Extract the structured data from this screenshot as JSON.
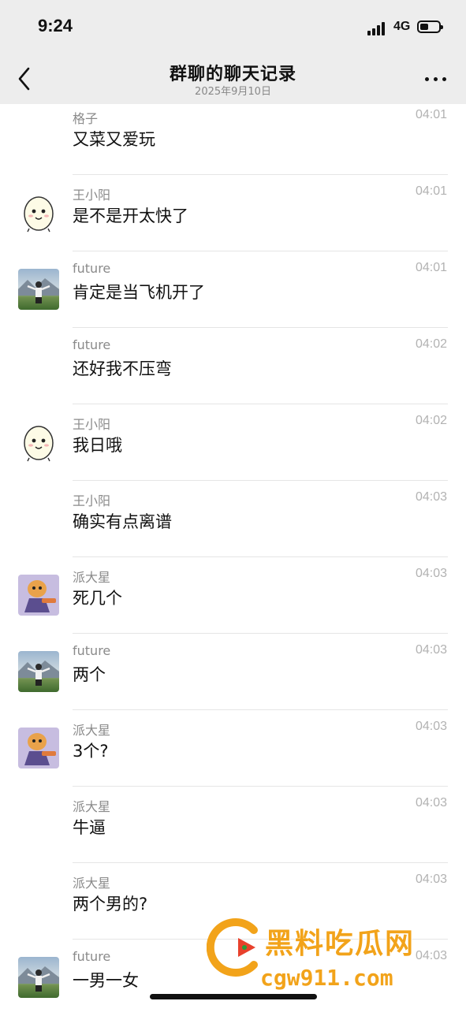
{
  "status": {
    "time": "9:24",
    "network": "4G",
    "battery_level": 0.45
  },
  "header": {
    "title": "群聊的聊天记录",
    "subtitle": "2025年9月10日"
  },
  "messages": [
    {
      "sender": "格子",
      "time": "04:01",
      "text": "又菜又爱玩",
      "avatar": "none"
    },
    {
      "sender": "王小阳",
      "time": "04:01",
      "text": "是不是开太快了",
      "avatar": "egg"
    },
    {
      "sender": "future",
      "time": "04:01",
      "text": "肯定是当飞机开了",
      "avatar": "future"
    },
    {
      "sender": "future",
      "time": "04:02",
      "text": "还好我不压弯",
      "avatar": "none"
    },
    {
      "sender": "王小阳",
      "time": "04:02",
      "text": "我日哦",
      "avatar": "egg"
    },
    {
      "sender": "王小阳",
      "time": "04:03",
      "text": "确实有点离谱",
      "avatar": "none"
    },
    {
      "sender": "派大星",
      "time": "04:03",
      "text": "死几个",
      "avatar": "pai"
    },
    {
      "sender": "future",
      "time": "04:03",
      "text": "两个",
      "avatar": "future"
    },
    {
      "sender": "派大星",
      "time": "04:03",
      "text": "3个?",
      "avatar": "pai"
    },
    {
      "sender": "派大星",
      "time": "04:03",
      "text": "牛逼",
      "avatar": "none"
    },
    {
      "sender": "派大星",
      "time": "04:03",
      "text": "两个男的?",
      "avatar": "none"
    },
    {
      "sender": "future",
      "time": "04:03",
      "text": "一男一女",
      "avatar": "future"
    }
  ],
  "watermark": {
    "text": "黑料吃瓜网",
    "url": "cgw911.com"
  },
  "icons": {
    "back": "chevron-left-icon",
    "more": "more-dots-icon"
  }
}
